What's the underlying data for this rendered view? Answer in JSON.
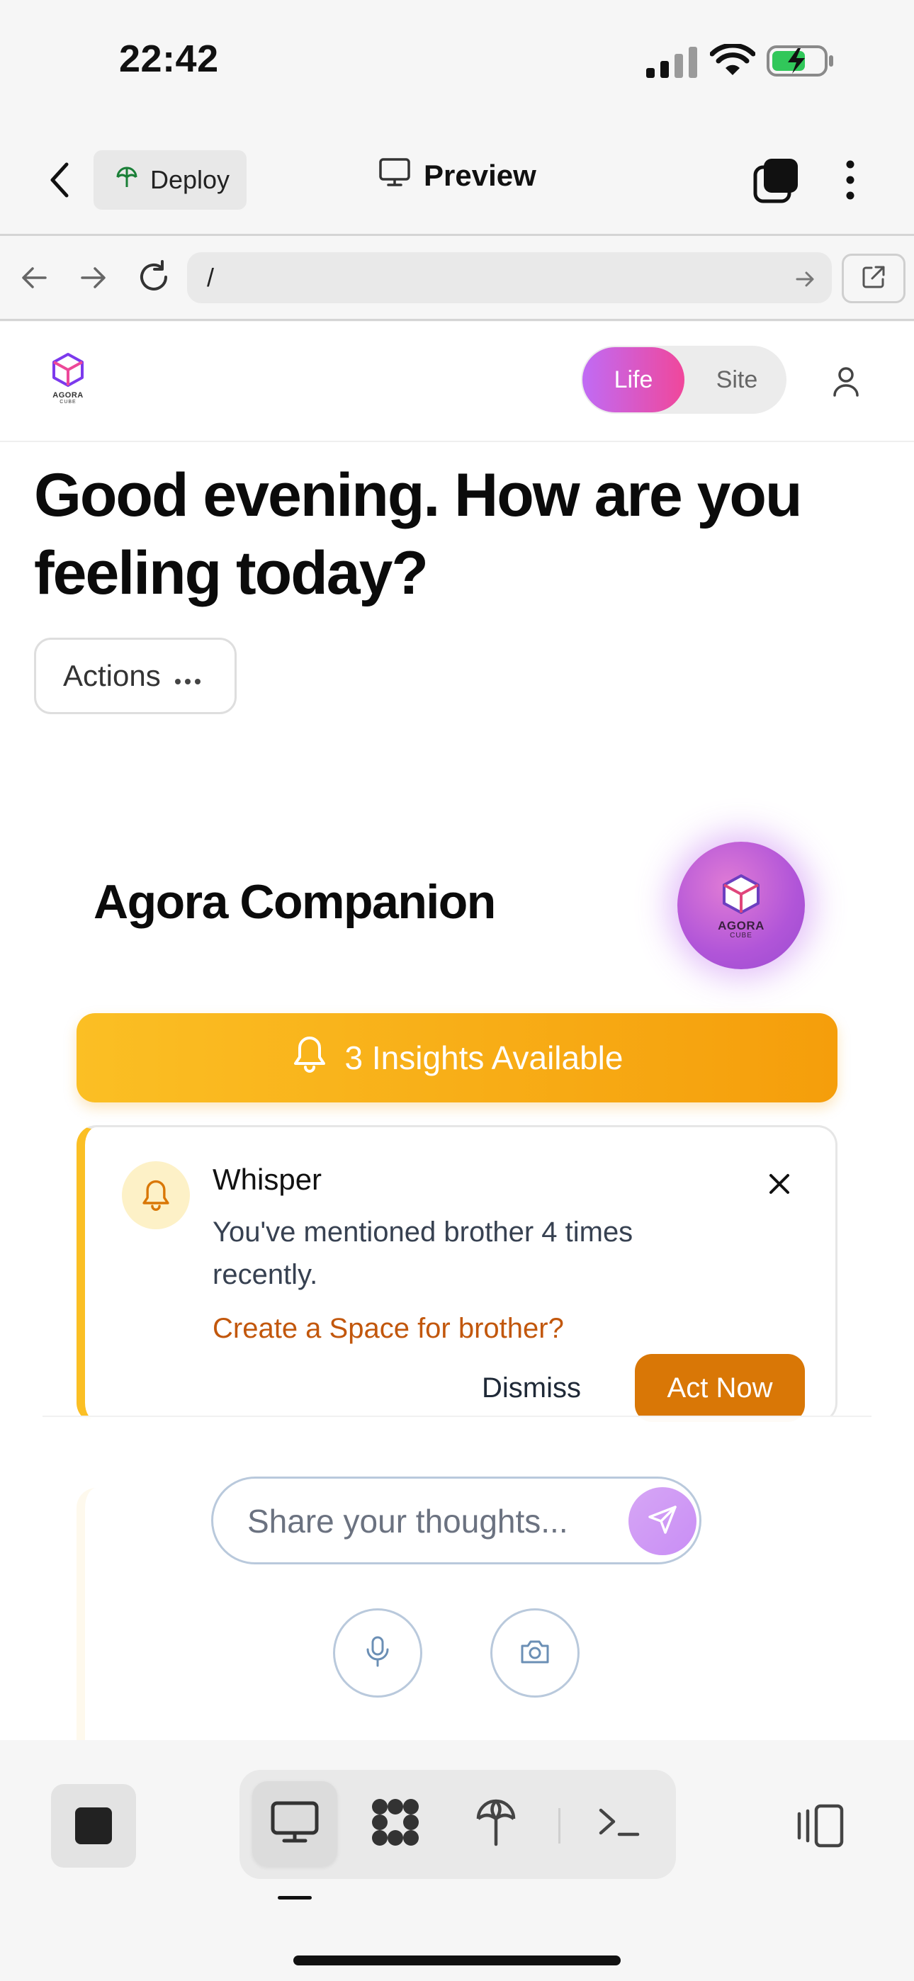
{
  "status_bar": {
    "time": "22:42"
  },
  "header": {
    "deploy_label": "Deploy",
    "preview_label": "Preview"
  },
  "browser": {
    "url": "/"
  },
  "app": {
    "logo_text": "AGORA",
    "logo_sub": "CUBE",
    "toggle": {
      "life": "Life",
      "site": "Site",
      "selected": "Life"
    },
    "greeting": "Good evening. How are you feeling today?",
    "actions_label": "Actions",
    "companion_title": "Agora Companion",
    "insights_label": "3 Insights Available",
    "whisper": {
      "title": "Whisper",
      "message": "You've mentioned brother 4 times recently.",
      "link": "Create a Space for brother?",
      "dismiss": "Dismiss",
      "act_now": "Act Now"
    },
    "input": {
      "placeholder": "Share your thoughts..."
    }
  },
  "colors": {
    "accent_gradient_start": "#c06bf5",
    "accent_gradient_end": "#f0479b",
    "insight": "#f59e0b",
    "link": "#c2570c",
    "act_now": "#d97706"
  },
  "icons": {
    "header": [
      "back-icon",
      "globe-icon",
      "monitor-icon",
      "tabs-icon",
      "more-vertical-icon"
    ],
    "browser": [
      "arrow-left-icon",
      "arrow-right-icon",
      "reload-icon",
      "go-icon",
      "open-external-icon"
    ],
    "toolbar": [
      "stop-icon",
      "monitor-icon",
      "apps-icon",
      "deploy-icon",
      "terminal-icon",
      "panel-toggle-icon"
    ]
  }
}
